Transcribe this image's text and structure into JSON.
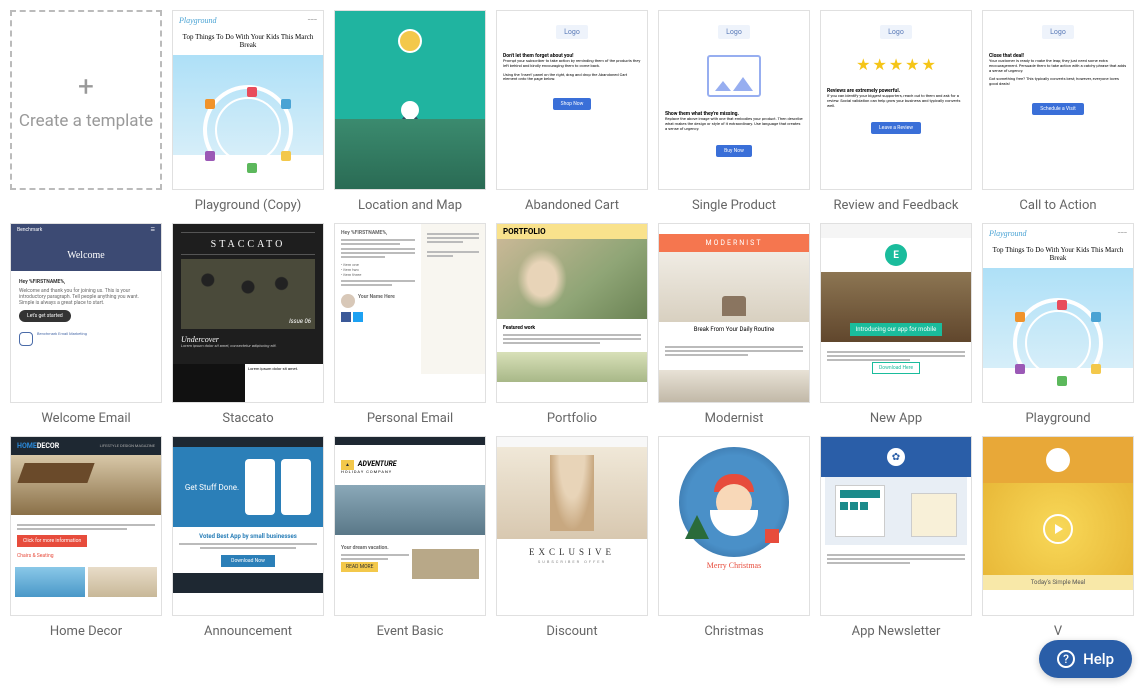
{
  "create_card": {
    "label": "Create a template"
  },
  "templates": {
    "playground_copy": {
      "label": "Playground (Copy)",
      "brand": "Playground",
      "headline": "Top Things To Do With Your Kids This March Break"
    },
    "location_map": {
      "label": "Location and Map"
    },
    "abandoned_cart": {
      "label": "Abandoned Cart",
      "logo": "Logo",
      "h1": "Don't let them forget about you!",
      "btn": "Shop Now",
      "p1": "Prompt your subscriber to take action by reminding them of the products they left behind and kindly encouraging them to come back.",
      "p2": "Using the 'Insert' panel on the right, drag and drop the Abandoned Cart element onto the page below."
    },
    "single_product": {
      "label": "Single Product",
      "logo": "Logo",
      "h1": "Show them what they're missing.",
      "btn": "Buy Now",
      "p1": "Replace the above image with one that embodies your product. Then describe what makes the design or style of it extraordinary. Use language that creates a sense of urgency."
    },
    "review_feedback": {
      "label": "Review and Feedback",
      "logo": "Logo",
      "h1": "Reviews are extremely powerful.",
      "btn": "Leave a Review",
      "p1": "If you can identify your biggest supporters, reach out to them and ask for a review. Social validation can help grow your business and typically converts well."
    },
    "call_to_action": {
      "label": "Call to Action",
      "logo": "Logo",
      "h1": "Close that deal!",
      "btn": "Schedule a Visit",
      "p1": "Your customer is ready to make the leap; they just need some extra encouragement. Persuade them to take action with a catchy phrase that adds a sense of urgency.",
      "p2": "Got something free? This typically converts best; however, everyone loves good deals!"
    },
    "welcome_email": {
      "label": "Welcome Email",
      "brand": "Benchmark",
      "banner": "Welcome",
      "greeting": "Hey %FIRSTNAME%,",
      "body": "Welcome and thank you for joining us. This is your introductory paragraph. Tell people anything you want. Simple is always a great place to start.",
      "btn": "Let's get started",
      "footer": "Benchmark Email Marketing"
    },
    "staccato": {
      "label": "Staccato",
      "title": "STACCATO",
      "issue": "Issue 06",
      "sub": "Undercover",
      "blurb": "Lorem ipsum dolor sit amet, consectetur adipiscing elit."
    },
    "personal_email": {
      "label": "Personal Email",
      "greeting": "Hey %FIRSTNAME%,",
      "signoff": "Your Name Here"
    },
    "portfolio": {
      "label": "Portfolio",
      "title": "PORTFOLIO"
    },
    "modernist": {
      "label": "Modernist",
      "title": "MODERNIST",
      "tagline": "Break From Your Daily Routine"
    },
    "new_app": {
      "label": "New App",
      "e": "E",
      "hero": "Introducing our app for mobile",
      "cta": "Download Here"
    },
    "playground": {
      "label": "Playground",
      "brand": "Playground",
      "headline": "Top Things To Do With Your Kids This March Break"
    },
    "home_decor": {
      "label": "Home Decor",
      "logo_a": "HOME",
      "logo_b": "DECOR",
      "tag": "LIFESTYLE DESIGN MAGAZINE",
      "btn": "Click for more information",
      "section": "Chairs & Seating"
    },
    "announcement": {
      "label": "Announcement",
      "hero": "Get Stuff Done.",
      "voted": "Voted Best App by small businesses",
      "btn": "Download Now"
    },
    "event_basic": {
      "label": "Event Basic",
      "company": "ADVENTURE",
      "sub": "HOLIDAY COMPANY",
      "dream": "Your dream vacation.",
      "read": "READ MORE"
    },
    "discount": {
      "label": "Discount",
      "title": "EXCLUSIVE",
      "sub": "SUBSCRIBER OFFER"
    },
    "christmas": {
      "label": "Christmas",
      "greeting": "Merry Christmas"
    },
    "app_newsletter": {
      "label": "App Newsletter"
    },
    "video": {
      "label": "V",
      "footer": "Today's Simple Meal"
    }
  },
  "help": {
    "label": "Help"
  }
}
